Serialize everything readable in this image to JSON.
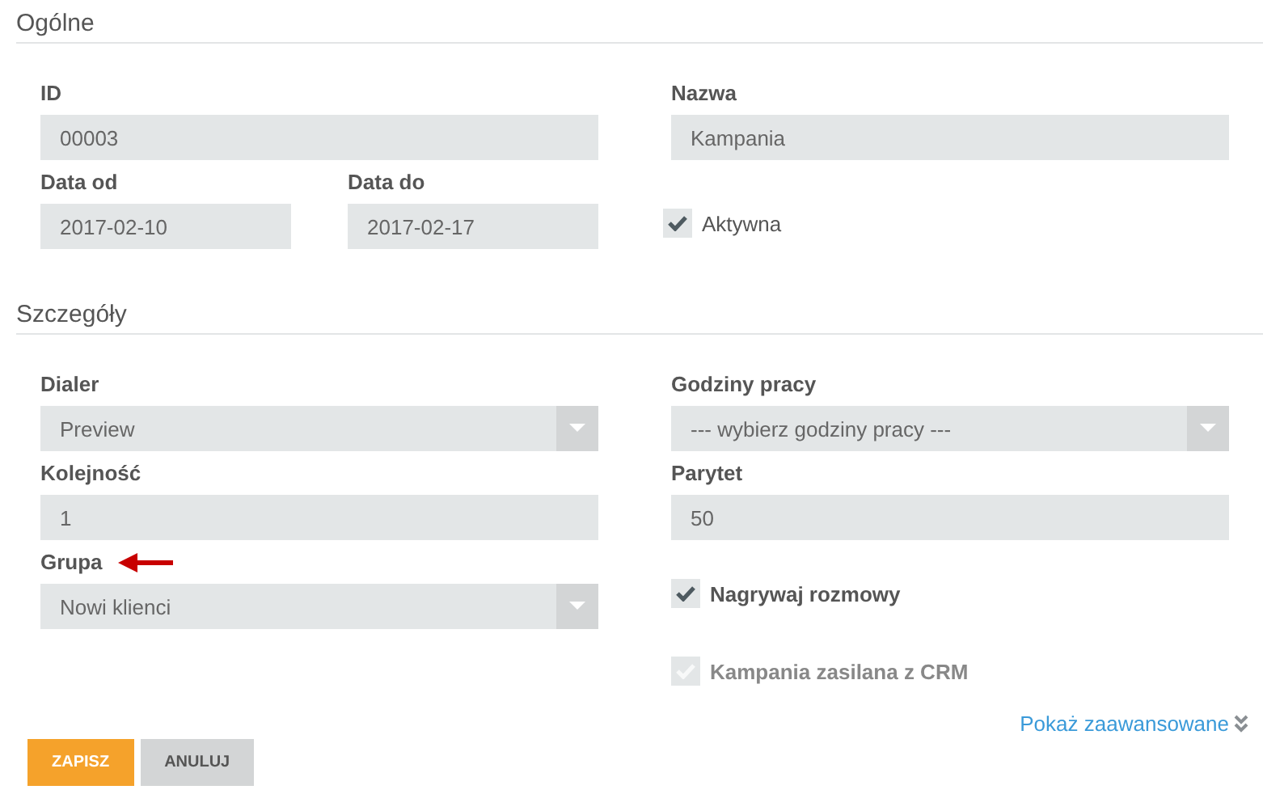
{
  "sections": [
    {
      "title": "Ogólne",
      "left": [
        {
          "kind": "text",
          "label": "ID",
          "value": "00003"
        },
        {
          "kind": "pair",
          "items": [
            {
              "kind": "text",
              "label": "Data od",
              "value": "2017-02-10"
            },
            {
              "kind": "text",
              "label": "Data do",
              "value": "2017-02-17"
            }
          ]
        }
      ],
      "right": [
        {
          "kind": "text",
          "label": "Nazwa",
          "value": "Kampania"
        },
        {
          "kind": "checkbox",
          "label": "Aktywna",
          "checked": true,
          "disabled": false,
          "bold": false
        }
      ]
    },
    {
      "title": "Szczegóły",
      "left": [
        {
          "kind": "select",
          "label": "Dialer",
          "value": "Preview",
          "marked": false
        },
        {
          "kind": "text",
          "label": "Kolejność",
          "value": "1"
        },
        {
          "kind": "select",
          "label": "Grupa",
          "value": "Nowi klienci",
          "marked": true
        }
      ],
      "right": [
        {
          "kind": "select",
          "label": "Godziny pracy",
          "value": "--- wybierz godziny pracy ---",
          "marked": false
        },
        {
          "kind": "text",
          "label": "Parytet",
          "value": "50"
        },
        {
          "kind": "checkbox",
          "label": "Nagrywaj rozmowy",
          "checked": true,
          "disabled": false,
          "bold": true
        },
        {
          "kind": "checkbox",
          "label": "Kampania zasilana z CRM",
          "checked": true,
          "disabled": true,
          "bold": true
        }
      ]
    }
  ],
  "advanced_link": "Pokaż zaawansowane",
  "buttons": [
    {
      "label": "ZAPISZ",
      "kind": "primary"
    },
    {
      "label": "ANULUJ",
      "kind": "secondary"
    }
  ]
}
